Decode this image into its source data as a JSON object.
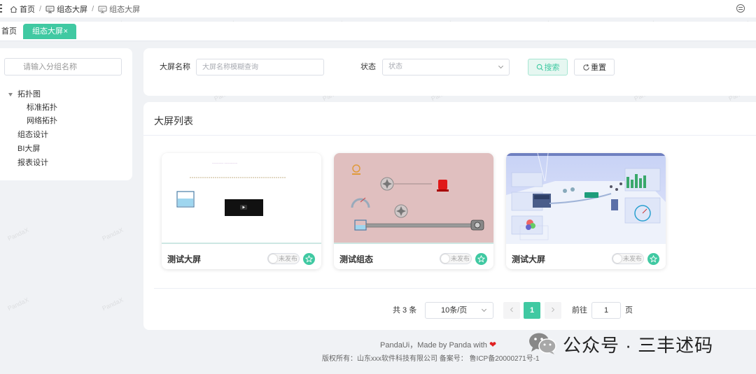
{
  "breadcrumb": {
    "items": [
      {
        "label": "首页",
        "icon": "home-icon"
      },
      {
        "label": "组态大屏",
        "icon": "monitor-icon"
      },
      {
        "label": "组态大屏",
        "icon": "monitor-icon"
      }
    ]
  },
  "tags": {
    "home": "首页",
    "active": "组态大屏",
    "close": "×"
  },
  "tree": {
    "search_placeholder": "请输入分组名称",
    "nodes": [
      {
        "label": "拓扑图"
      },
      {
        "label": "标准拓扑"
      },
      {
        "label": "网络拓扑"
      },
      {
        "label": "组态设计"
      },
      {
        "label": "BI大屏"
      },
      {
        "label": "报表设计"
      }
    ]
  },
  "filters": {
    "name_label": "大屏名称",
    "name_placeholder": "大屏名称模糊查询",
    "status_label": "状态",
    "status_placeholder": "状态",
    "search_button": "搜索",
    "reset_button": "重置"
  },
  "list": {
    "title": "大屏列表",
    "cards": [
      {
        "name": "测试大屏",
        "status": "未发布"
      },
      {
        "name": "测试组态",
        "status": "未发布"
      },
      {
        "name": "测试大屏",
        "status": "未发布"
      }
    ]
  },
  "pagination": {
    "total": "共 3 条",
    "page_size": "10条/页",
    "current": "1",
    "goto_label": "前往",
    "goto_value": "1",
    "page_suffix": "页"
  },
  "footer": {
    "made_by": "PandaUi，Made by Panda with",
    "copyright": "版权所有：山东xxx软件科技有限公司 备案号： 鲁ICP备20000271号-1"
  },
  "wechat": {
    "text": "公众号 · 三丰述码"
  },
  "watermark": "PandaX",
  "colors": {
    "accent": "#40c9a2",
    "heart": "#e02020"
  }
}
